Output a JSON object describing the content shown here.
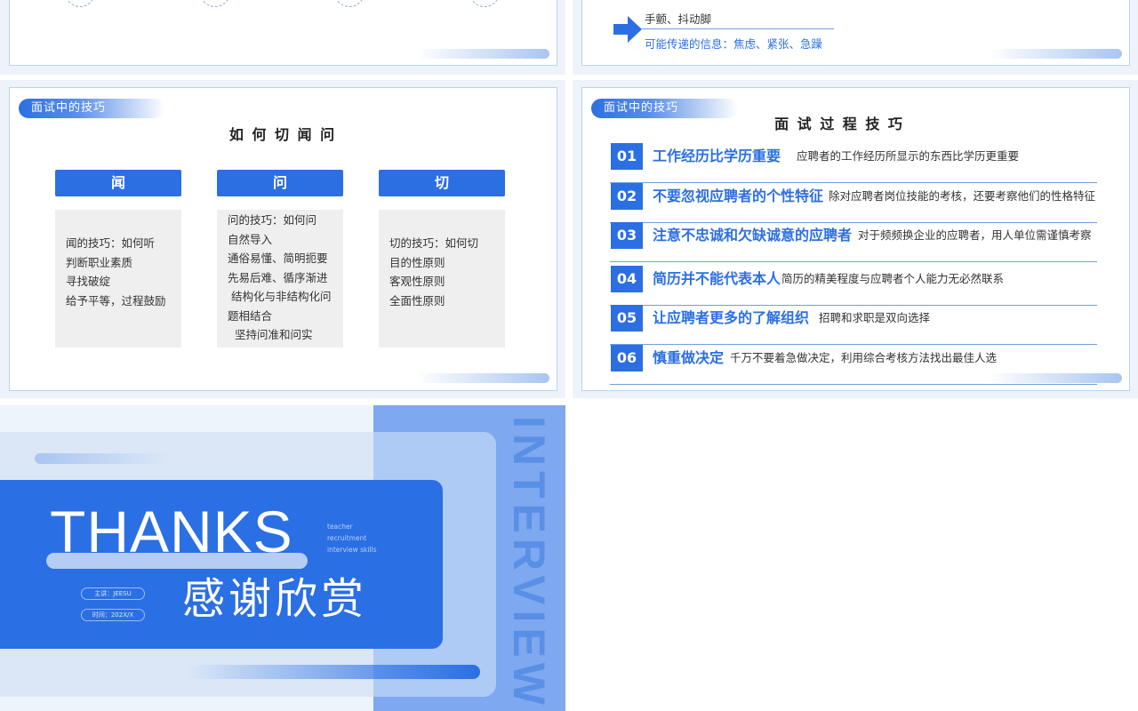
{
  "slide_tl": {},
  "slide_tr": {
    "gesture_line": "手颤、抖动脚",
    "signal_line": "可能传递的信息：焦虑、紧张、急躁"
  },
  "slide_ml": {
    "tag": "面试中的技巧",
    "title": "如 何 切 闻 问",
    "columns": [
      {
        "head": "闻",
        "body": "闻的技巧：如何听\n判断职业素质\n寻找破绽\n给予平等，过程鼓励"
      },
      {
        "head": "问",
        "body": "问的技巧：如何问\n自然导入\n通俗易懂、简明扼要\n先易后难、循序渐进\n 结构化与非结构化问\n题相结合\n  坚持问准和问实"
      },
      {
        "head": "切",
        "body": "切的技巧：如何切\n目的性原则\n客观性原则\n全面性原则"
      }
    ]
  },
  "slide_mr": {
    "tag": "面试中的技巧",
    "title": "面 试 过 程 技 巧",
    "rows": [
      {
        "num": "01",
        "title": "工作经历比学历重要",
        "desc": "应聘者的工作经历所显示的东西比学历更重要"
      },
      {
        "num": "02",
        "title": "不要忽视应聘者的个性特征",
        "desc": "除对应聘者岗位技能的考核，还要考察他们的性格特征"
      },
      {
        "num": "03",
        "title": "注意不忠诚和欠缺诚意的应聘者",
        "desc": "对于频频换企业的应聘者，用人单位需谨慎考察"
      },
      {
        "num": "04",
        "title": "简历并不能代表本人",
        "desc": "简历的精美程度与应聘者个人能力无必然联系"
      },
      {
        "num": "05",
        "title": "让应聘者更多的了解组织",
        "desc": "招聘和求职是双向选择"
      },
      {
        "num": "06",
        "title": "慎重做决定",
        "desc": "千万不要着急做决定，利用综合考核方法找出最佳人选"
      }
    ]
  },
  "slide_bl": {
    "thanks": "THANKS",
    "subtitle": "感谢欣赏",
    "side_word": "INTERVIEW",
    "small_lines": [
      "teacher",
      "recruitment",
      "interview skills"
    ],
    "pill_speaker": "主讲：JEESU",
    "pill_time": "时间：202X/X"
  }
}
